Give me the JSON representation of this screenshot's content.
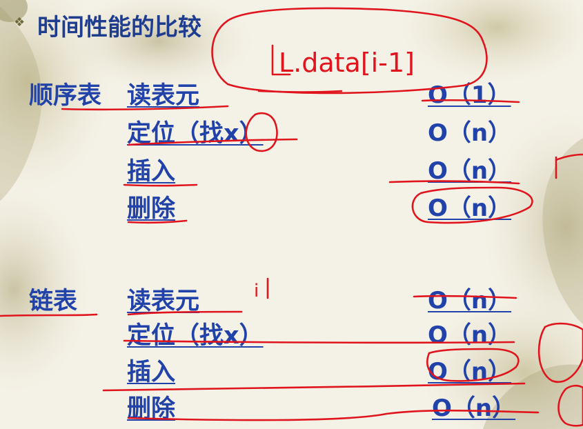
{
  "slide": {
    "bullet_glyph": "❖",
    "title": "时间性能的比较"
  },
  "sections": [
    {
      "structure": "顺序表",
      "operations": [
        {
          "name": "读表元",
          "complexity": "O（1）"
        },
        {
          "name": "定位（找x）",
          "complexity": "O（n）"
        },
        {
          "name": "插入",
          "complexity": "O（n）"
        },
        {
          "name": "删除",
          "complexity": "O（n）"
        }
      ]
    },
    {
      "structure": "链表",
      "operations": [
        {
          "name": "读表元",
          "complexity": "O（n）"
        },
        {
          "name": "定位（找x）",
          "complexity": "O（n）"
        },
        {
          "name": "插入",
          "complexity": "O（n）"
        },
        {
          "name": "删除",
          "complexity": "O（n）"
        }
      ]
    }
  ],
  "annotations": {
    "handwritten_note": "L.data[i-1]",
    "side_mark": "i"
  },
  "colors": {
    "text": "#2143a9",
    "title": "#1f3d8f",
    "ink": "#e0141c",
    "background": "#f4f1e6"
  }
}
